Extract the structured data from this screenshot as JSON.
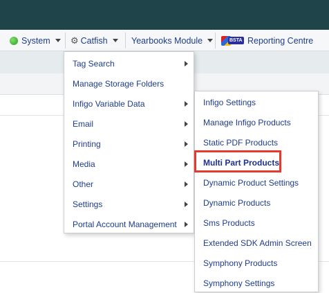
{
  "menubar": {
    "items": [
      {
        "label": "System",
        "icon": "globe-icon"
      },
      {
        "label": "Catfish",
        "icon": "gear-icon"
      },
      {
        "label": "Yearbooks Module"
      },
      {
        "label": "Reporting Centre",
        "icon": "bsta-logo-icon",
        "logo_text": "BSTA"
      }
    ]
  },
  "catfish_menu": {
    "items": [
      {
        "label": "Tag Search",
        "has_submenu": true
      },
      {
        "label": "Manage Storage Folders",
        "has_submenu": false
      },
      {
        "label": "Infigo Variable Data",
        "has_submenu": true
      },
      {
        "label": "Email",
        "has_submenu": true
      },
      {
        "label": "Printing",
        "has_submenu": true
      },
      {
        "label": "Media",
        "has_submenu": true
      },
      {
        "label": "Other",
        "has_submenu": true
      },
      {
        "label": "Settings",
        "has_submenu": true
      },
      {
        "label": "Portal Account Management",
        "has_submenu": true
      }
    ]
  },
  "infigo_submenu": {
    "items": [
      {
        "label": "Infigo Settings"
      },
      {
        "label": "Manage Infigo Products"
      },
      {
        "label": "Static PDF Products"
      },
      {
        "label": "Multi Part Products",
        "highlighted": true
      },
      {
        "label": "Dynamic Product Settings"
      },
      {
        "label": "Dynamic Products"
      },
      {
        "label": "Sms Products"
      },
      {
        "label": "Extended SDK Admin Screen"
      },
      {
        "label": "Symphony Products"
      },
      {
        "label": "Symphony Settings"
      }
    ]
  },
  "colors": {
    "topbar": "#1f454b",
    "link": "#1e3c8c",
    "highlight_border": "#e63a2e"
  }
}
